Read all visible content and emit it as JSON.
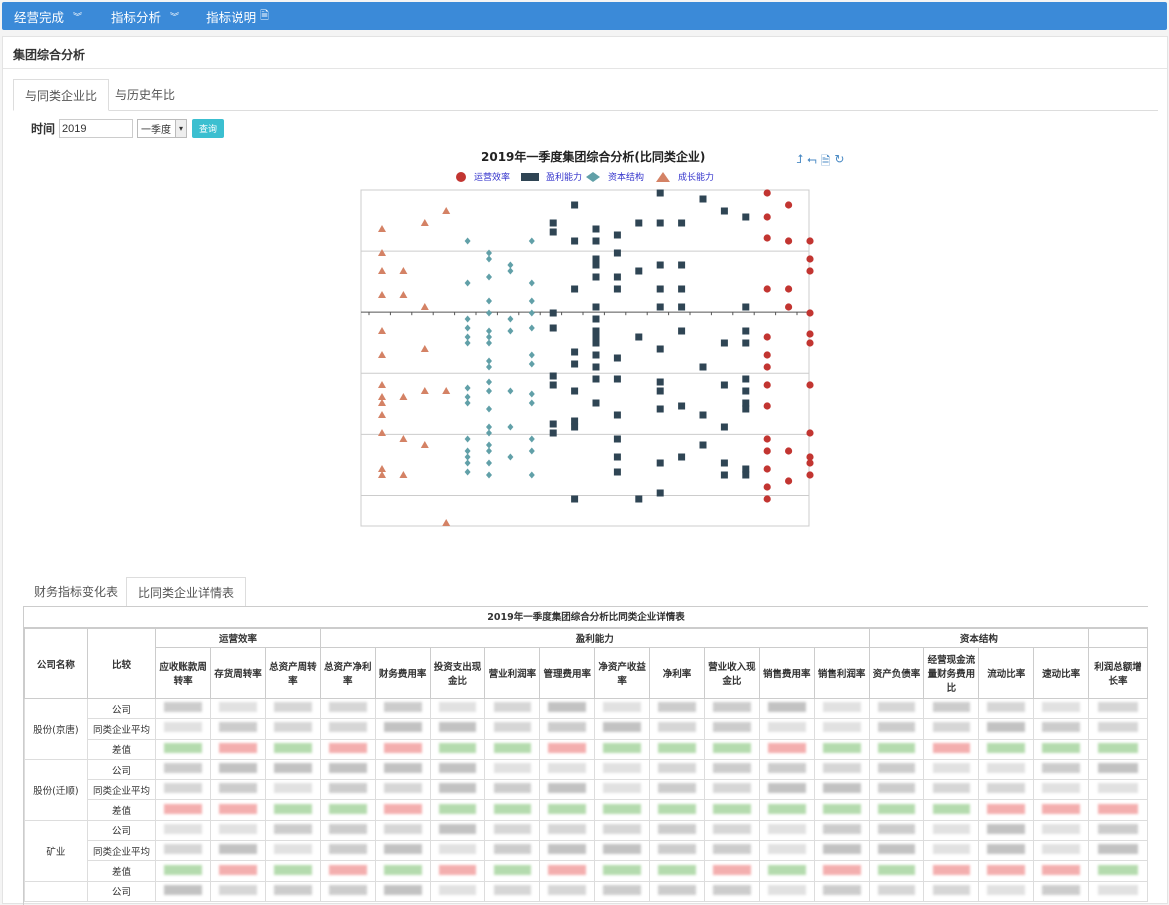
{
  "nav": [
    {
      "label": "经营完成",
      "icon": "double-chevron-down-icon"
    },
    {
      "label": "指标分析",
      "icon": "double-chevron-down-icon"
    },
    {
      "label": "指标说明",
      "icon": "document-icon"
    }
  ],
  "panel_title": "集团综合分析",
  "tabs_top": [
    "与同类企业比",
    "与历史年比"
  ],
  "time": {
    "label": "时间",
    "year": "2019",
    "season": "一季度",
    "query_button": "查询"
  },
  "chart_toolbox": [
    "zoom-icon",
    "zoom-reset-icon",
    "data-view-icon",
    "restore-icon"
  ],
  "chart_data": {
    "type": "scatter",
    "title": "2019年一季度集团综合分析(比同类企业)",
    "legend": [
      {
        "name": "运营效率",
        "shape": "circle",
        "color": "#c23531"
      },
      {
        "name": "盈利能力",
        "shape": "rect",
        "color": "#2f4554"
      },
      {
        "name": "资本结构",
        "shape": "diamond",
        "color": "#61a0a8"
      },
      {
        "name": "成长能力",
        "shape": "triangle",
        "color": "#d48265"
      }
    ],
    "grid": true,
    "y_gridlines": [
      1,
      2,
      3,
      4,
      5
    ],
    "y_zero_line": 2,
    "series": [
      {
        "name": "成长能力",
        "points": [
          [
            1,
            6.0
          ],
          [
            1,
            10.0
          ],
          [
            1,
            13.0
          ],
          [
            1,
            17.0
          ],
          [
            1,
            23.0
          ],
          [
            1,
            27.0
          ],
          [
            1,
            32.0
          ],
          [
            1,
            34.0
          ],
          [
            1,
            35.0
          ],
          [
            1,
            37.0
          ],
          [
            1,
            40.0
          ],
          [
            1,
            46.0
          ],
          [
            1,
            47.0
          ],
          [
            2,
            13.0
          ],
          [
            2,
            17.0
          ],
          [
            2,
            34.0
          ],
          [
            2,
            41.0
          ],
          [
            2,
            47.0
          ],
          [
            3,
            5.0
          ],
          [
            3,
            19.0
          ],
          [
            3,
            26.0
          ],
          [
            3,
            33.0
          ],
          [
            3,
            42.0
          ],
          [
            4,
            3.0
          ],
          [
            4,
            33.0
          ],
          [
            4,
            55.0
          ]
        ]
      },
      {
        "name": "资本结构",
        "points": [
          [
            5,
            8.0
          ],
          [
            5,
            15.0
          ],
          [
            5,
            21.0
          ],
          [
            5,
            22.5
          ],
          [
            5,
            24.0
          ],
          [
            5,
            25.0
          ],
          [
            5,
            32.5
          ],
          [
            5,
            34.0
          ],
          [
            5,
            35.0
          ],
          [
            5,
            41.0
          ],
          [
            5,
            43.0
          ],
          [
            5,
            44.0
          ],
          [
            5,
            45.0
          ],
          [
            5,
            46.5
          ],
          [
            6,
            10.0
          ],
          [
            6,
            11.0
          ],
          [
            6,
            14.0
          ],
          [
            6,
            18.0
          ],
          [
            6,
            20.0
          ],
          [
            6,
            23.0
          ],
          [
            6,
            24.0
          ],
          [
            6,
            25.0
          ],
          [
            6,
            28.0
          ],
          [
            6,
            29.0
          ],
          [
            6,
            31.5
          ],
          [
            6,
            33.0
          ],
          [
            6,
            36.0
          ],
          [
            6,
            39.0
          ],
          [
            6,
            40.0
          ],
          [
            6,
            42.0
          ],
          [
            6,
            43.0
          ],
          [
            6,
            45.0
          ],
          [
            6,
            47.0
          ],
          [
            7,
            12.0
          ],
          [
            7,
            13.0
          ],
          [
            7,
            21.0
          ],
          [
            7,
            23.0
          ],
          [
            7,
            33.0
          ],
          [
            7,
            39.0
          ],
          [
            7,
            44.0
          ],
          [
            8,
            8.0
          ],
          [
            8,
            15.0
          ],
          [
            8,
            18.0
          ],
          [
            8,
            20.0
          ],
          [
            8,
            22.5
          ],
          [
            8,
            27.0
          ],
          [
            8,
            28.5
          ],
          [
            8,
            33.5
          ],
          [
            8,
            35.0
          ],
          [
            8,
            41.0
          ],
          [
            8,
            43.0
          ],
          [
            8,
            47.0
          ]
        ]
      },
      {
        "name": "盈利能力",
        "points": [
          [
            9,
            5.0
          ],
          [
            9,
            6.5
          ],
          [
            9,
            20.0
          ],
          [
            9,
            22.5
          ],
          [
            9,
            30.5
          ],
          [
            9,
            32.0
          ],
          [
            9,
            38.5
          ],
          [
            9,
            40.0
          ],
          [
            10,
            2.0
          ],
          [
            10,
            8.0
          ],
          [
            10,
            16.0
          ],
          [
            10,
            26.5
          ],
          [
            10,
            28.5
          ],
          [
            10,
            33.0
          ],
          [
            10,
            38.0
          ],
          [
            10,
            39.0
          ],
          [
            10,
            51.0
          ],
          [
            11,
            6.0
          ],
          [
            11,
            8.0
          ],
          [
            11,
            11.0
          ],
          [
            11,
            12.0
          ],
          [
            11,
            14.0
          ],
          [
            11,
            19.0
          ],
          [
            11,
            21.0
          ],
          [
            11,
            23.0
          ],
          [
            11,
            24.0
          ],
          [
            11,
            25.0
          ],
          [
            11,
            27.0
          ],
          [
            11,
            29.0
          ],
          [
            11,
            31.0
          ],
          [
            11,
            35.0
          ],
          [
            12,
            7.0
          ],
          [
            12,
            10.0
          ],
          [
            12,
            14.0
          ],
          [
            12,
            16.0
          ],
          [
            12,
            27.5
          ],
          [
            12,
            31.0
          ],
          [
            12,
            37.0
          ],
          [
            12,
            41.0
          ],
          [
            12,
            44.0
          ],
          [
            12,
            46.5
          ],
          [
            13,
            5.0
          ],
          [
            13,
            13.0
          ],
          [
            13,
            24.0
          ],
          [
            13,
            51.0
          ],
          [
            14,
            0.0
          ],
          [
            14,
            5.0
          ],
          [
            14,
            12.0
          ],
          [
            14,
            16.0
          ],
          [
            14,
            19.0
          ],
          [
            14,
            26.0
          ],
          [
            14,
            31.5
          ],
          [
            14,
            33.0
          ],
          [
            14,
            36.0
          ],
          [
            14,
            45.0
          ],
          [
            14,
            50.0
          ],
          [
            15,
            5.0
          ],
          [
            15,
            12.0
          ],
          [
            15,
            16.0
          ],
          [
            15,
            19.0
          ],
          [
            15,
            23.0
          ],
          [
            15,
            35.5
          ],
          [
            15,
            44.0
          ],
          [
            16,
            1.0
          ],
          [
            16,
            29.0
          ],
          [
            16,
            37.0
          ],
          [
            16,
            42.0
          ],
          [
            17,
            3.0
          ],
          [
            17,
            25.0
          ],
          [
            17,
            32.0
          ],
          [
            17,
            39.0
          ],
          [
            17,
            45.0
          ],
          [
            17,
            47.0
          ],
          [
            18,
            4.0
          ],
          [
            18,
            19.0
          ],
          [
            18,
            23.0
          ],
          [
            18,
            25.0
          ],
          [
            18,
            31.0
          ],
          [
            18,
            33.0
          ],
          [
            18,
            35.0
          ],
          [
            18,
            36.0
          ],
          [
            18,
            46.0
          ],
          [
            18,
            47.0
          ]
        ]
      },
      {
        "name": "运营效率",
        "points": [
          [
            19,
            0.0
          ],
          [
            19,
            4.0
          ],
          [
            19,
            7.5
          ],
          [
            19,
            16.0
          ],
          [
            19,
            24.0
          ],
          [
            19,
            27.0
          ],
          [
            19,
            29.0
          ],
          [
            19,
            32.0
          ],
          [
            19,
            35.5
          ],
          [
            19,
            41.0
          ],
          [
            19,
            43.0
          ],
          [
            19,
            46.0
          ],
          [
            19,
            49.0
          ],
          [
            19,
            51.0
          ],
          [
            20,
            2.0
          ],
          [
            20,
            8.0
          ],
          [
            20,
            16.0
          ],
          [
            20,
            19.0
          ],
          [
            20,
            43.0
          ],
          [
            20,
            48.0
          ],
          [
            21,
            8.0
          ],
          [
            21,
            11.0
          ],
          [
            21,
            13.0
          ],
          [
            21,
            20.0
          ],
          [
            21,
            23.5
          ],
          [
            21,
            25.0
          ],
          [
            21,
            32.0
          ],
          [
            21,
            40.0
          ],
          [
            21,
            44.0
          ],
          [
            21,
            45.0
          ],
          [
            21,
            47.0
          ]
        ]
      }
    ]
  },
  "tabs_bottom": [
    "财务指标变化表",
    "比同类企业详情表"
  ],
  "table": {
    "title": "2019年一季度集团综合分析比同类企业详情表",
    "col_company": "公司名称",
    "col_compare": "比较",
    "groups": [
      {
        "name": "运营效率",
        "cols": [
          "应收账款周转率",
          "存货周转率",
          "总资产周转率"
        ]
      },
      {
        "name": "盈利能力",
        "cols": [
          "总资产净利率",
          "财务费用率",
          "投资支出现金比",
          "营业利润率",
          "管理费用率",
          "净资产收益率",
          "净利率",
          "营业收入现金比",
          "销售费用率",
          "销售利润率"
        ]
      },
      {
        "name": "资本结构",
        "cols": [
          "资产负债率",
          "经营现金流量财务费用比",
          "流动比率",
          "速动比率"
        ]
      },
      {
        "name": "",
        "cols": [
          "利润总额增长率"
        ]
      }
    ],
    "rows": [
      {
        "company": "股份(京唐)",
        "compare": [
          "公司",
          "同类企业平均",
          "差值"
        ]
      },
      {
        "company": "股份(迁顺)",
        "compare": [
          "公司",
          "同类企业平均",
          "差值"
        ]
      },
      {
        "company": "矿业",
        "compare": [
          "公司",
          "同类企业平均",
          "差值"
        ]
      },
      {
        "company": "",
        "compare": [
          "公司"
        ]
      }
    ]
  }
}
